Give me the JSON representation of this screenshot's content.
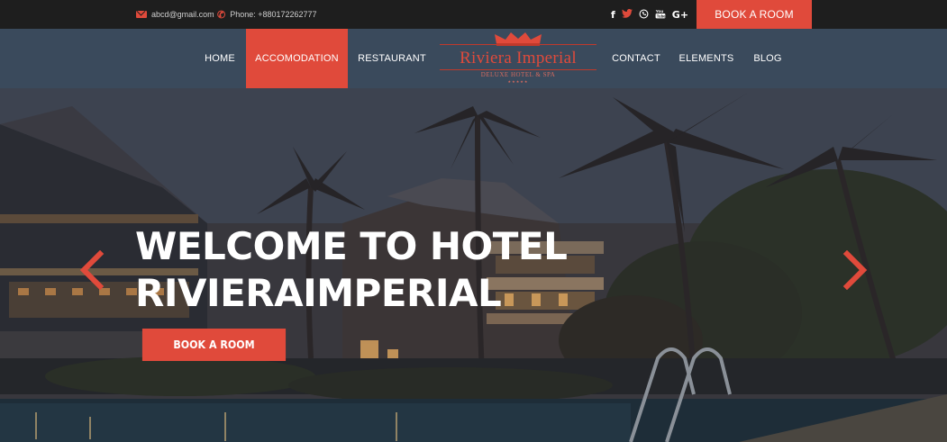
{
  "topbar": {
    "email": "abcd@gmail.com",
    "phone": "Phone: +880172262777",
    "social": {
      "facebook": "f",
      "twitter": "🐦",
      "whatsapp": "✆",
      "youtube": "▶",
      "googleplus": "G+"
    },
    "book_label": "BOOK A ROOM"
  },
  "nav": {
    "items": [
      {
        "label": "HOME"
      },
      {
        "label": "ACCOMODATION"
      },
      {
        "label": "RESTAURANT"
      },
      {
        "label": "CONTACT"
      },
      {
        "label": "ELEMENTS"
      },
      {
        "label": "BLOG"
      }
    ],
    "active": "ACCOMODATION"
  },
  "logo": {
    "title": "Riviera Imperial",
    "subtitle": "DELUXE HOTEL & SPA",
    "stars": "★★★★★"
  },
  "hero": {
    "title_line1": "WELCOME TO HOTEL",
    "title_line2": "RIVIERAIMPERIAL",
    "button_label": "BOOK A ROOM"
  },
  "colors": {
    "accent": "#e04a3b",
    "nav_bg": "#3a4a5c",
    "topbar_bg": "#1e1e1e"
  }
}
